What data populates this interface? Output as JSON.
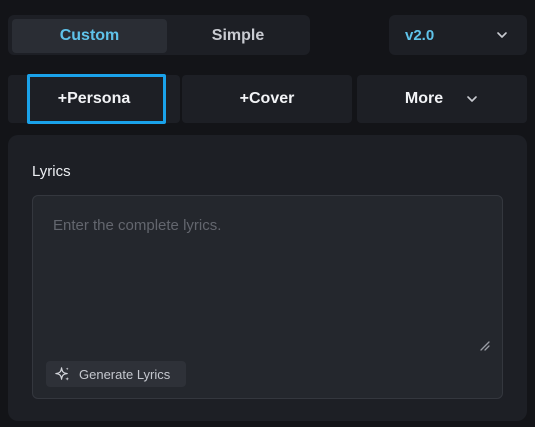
{
  "mode_tabs": {
    "custom": "Custom",
    "simple": "Simple",
    "active": "Custom"
  },
  "version": {
    "selected": "v2.0"
  },
  "actions": {
    "persona": "+Persona",
    "cover": "+Cover",
    "more": "More"
  },
  "lyrics": {
    "label": "Lyrics",
    "placeholder": "Enter the complete lyrics.",
    "value": "",
    "generate_button": "Generate Lyrics"
  },
  "colors": {
    "accent": "#5fc3ea",
    "focus": "#1aa2ea",
    "background": "#131418",
    "panel": "#1d1f25"
  },
  "icons": {
    "version_chevron": "chevron-down-icon",
    "more_chevron": "chevron-down-icon",
    "generate": "sparkle-icon",
    "resize": "resize-handle-icon"
  }
}
